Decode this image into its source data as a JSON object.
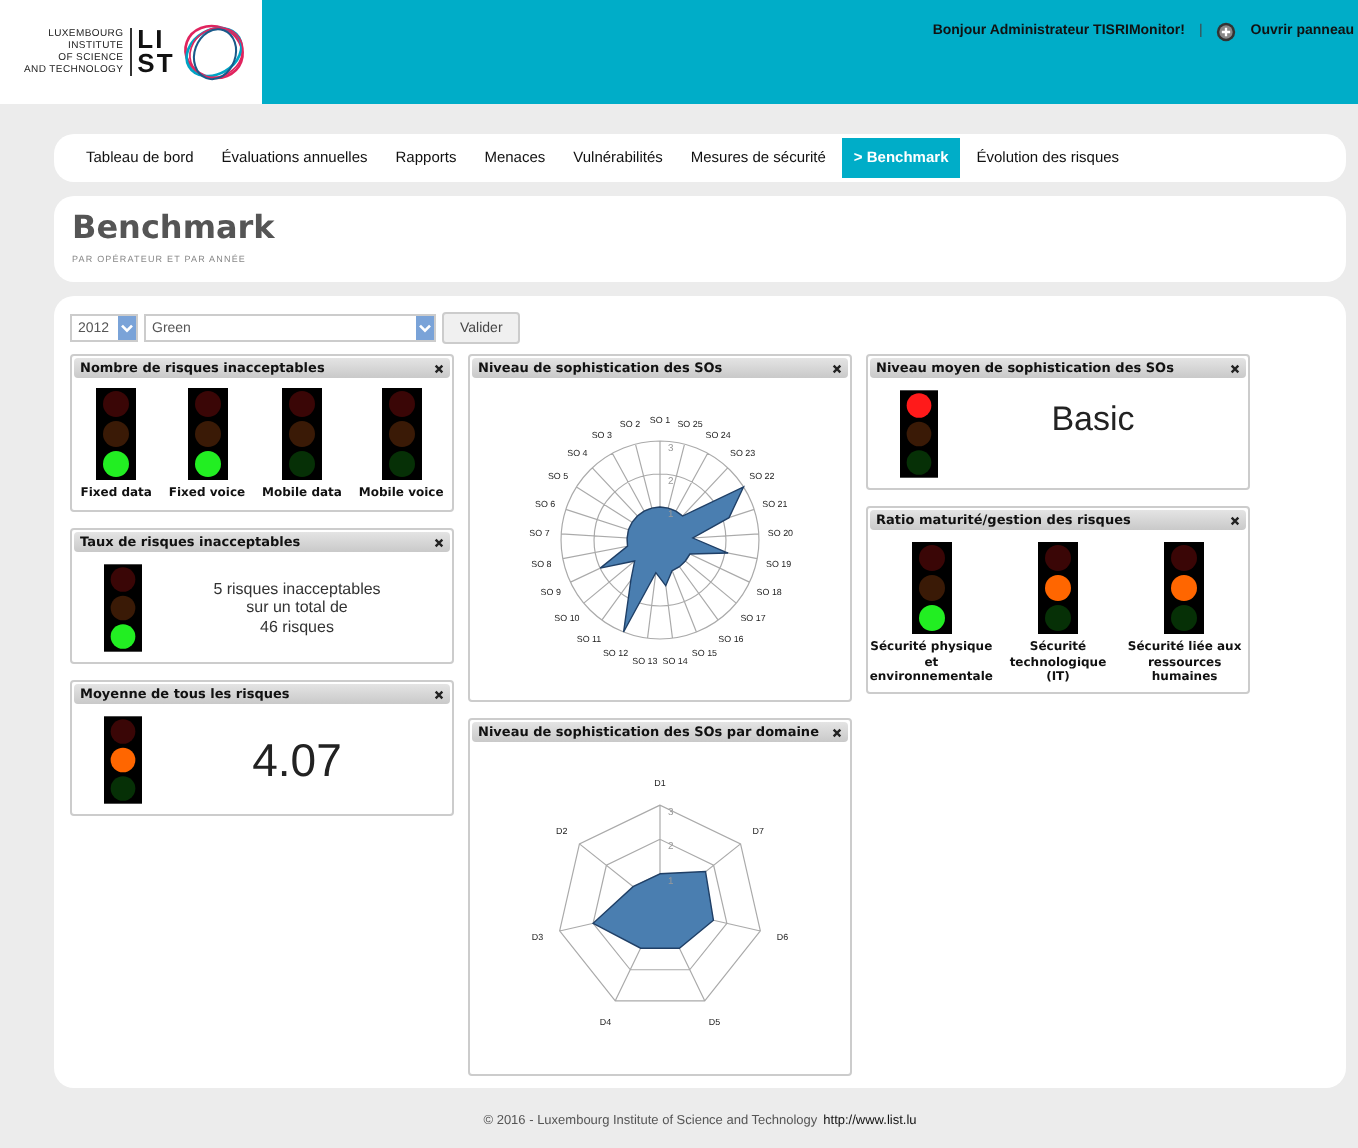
{
  "logo": {
    "lines": [
      "LUXEMBOURG",
      "INSTITUTE",
      "OF SCIENCE",
      "AND TECHNOLOGY"
    ],
    "mark": [
      "LI",
      "ST"
    ]
  },
  "header": {
    "greeting": "Bonjour Administrateur TISRIMonitor!",
    "separator": "|",
    "panel_link": "Ouvrir panneau"
  },
  "nav": [
    {
      "label": "Tableau de bord",
      "selected": false
    },
    {
      "label": "Évaluations annuelles",
      "selected": false
    },
    {
      "label": "Rapports",
      "selected": false
    },
    {
      "label": "Menaces",
      "selected": false
    },
    {
      "label": "Vulnérabilités",
      "selected": false
    },
    {
      "label": "Mesures de sécurité",
      "selected": false
    },
    {
      "label": "> Benchmark",
      "selected": true
    },
    {
      "label": "Évolution des risques",
      "selected": false
    }
  ],
  "page": {
    "title": "Benchmark",
    "subtitle": "PAR OPÉRATEUR ET PAR ANNÉE"
  },
  "filters": {
    "year": "2012",
    "operator": "Green",
    "submit": "Valider"
  },
  "widgets": {
    "unacceptable_count": {
      "title": "Nombre de risques inacceptables",
      "lights": [
        {
          "label": "Fixed data",
          "color": "#22ee22"
        },
        {
          "label": "Fixed voice",
          "color": "#22ee22"
        },
        {
          "label": "Mobile data"
        },
        {
          "label": "Mobile voice"
        }
      ]
    },
    "unacceptable_rate": {
      "title": "Taux de risques inacceptables",
      "color": "#22ee22",
      "lines": [
        "5 risques inacceptables",
        "sur un total de",
        "46 risques"
      ]
    },
    "average": {
      "title": "Moyenne de tous les risques",
      "color": "#ff6600",
      "value": "4.07"
    },
    "so_radar": {
      "title": "Niveau de sophistication des SOs",
      "axis_labels": [
        "SO 1",
        "SO 2",
        "SO 3",
        "SO 4",
        "SO 5",
        "SO 6",
        "SO 7",
        "SO 8",
        "SO 9",
        "SO 10",
        "SO 11",
        "SO 12",
        "SO 13",
        "SO 25",
        "SO 24",
        "SO 23",
        "SO 22",
        "SO 21",
        "SO 20",
        "SO 19",
        "SO 18",
        "SO 17",
        "SO 16",
        "SO 15",
        "SO 14"
      ],
      "ring_labels": [
        "3",
        "2",
        "1"
      ]
    },
    "domain_radar": {
      "title": "Niveau de sophistication des SOs par domaine",
      "axis_labels": [
        "D1",
        "D2",
        "D3",
        "D4",
        "D5",
        "D6",
        "D7"
      ],
      "ring_labels": [
        "3",
        "2",
        "1"
      ]
    },
    "mean_level": {
      "title": "Niveau moyen de sophistication des SOs",
      "color": "#ff1a1a",
      "value": "Basic"
    },
    "maturity": {
      "title": "Ratio maturité/gestion des risques",
      "lights": [
        {
          "label": "Sécurité physique et environnementale",
          "color": "#22ee22"
        },
        {
          "label": "Sécurité technologique (IT)",
          "color": "#ff6600"
        },
        {
          "label": "Sécurité liée aux ressources humaines",
          "color": "#ff6600"
        }
      ]
    }
  },
  "footer": {
    "text": "© 2016 - Luxembourg Institute of Science and Technology",
    "link": "http://www.list.lu"
  }
}
